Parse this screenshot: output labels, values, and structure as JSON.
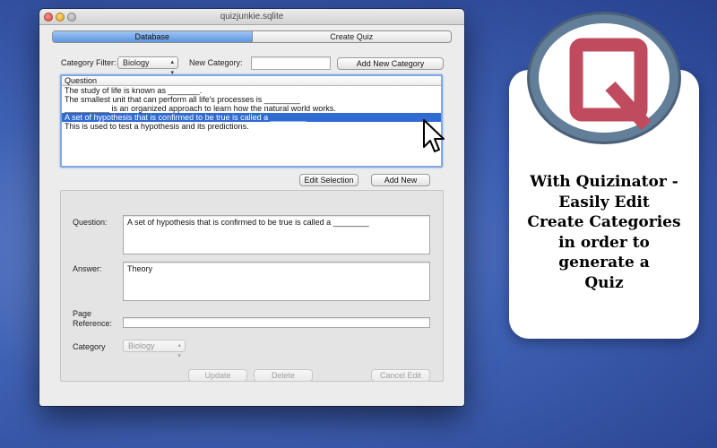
{
  "window": {
    "title": "quizjunkie.sqlite"
  },
  "tabs": [
    {
      "label": "Database",
      "active": true
    },
    {
      "label": "Create Quiz",
      "active": false
    }
  ],
  "filter_bar": {
    "category_filter_label": "Category Filter:",
    "category_filter_value": "Biology",
    "new_category_label": "New Category:",
    "new_category_value": "",
    "add_category_button": "Add New Category"
  },
  "question_table": {
    "column_header": "Question",
    "rows": [
      "The study of life is known as _______.",
      "The smallest unit that can perform all life's processes is ________",
      "__________ is an organized approach to learn how the natural world works.",
      "A set of hypothesis that is confirmed to be true is called a ________",
      "This is used to test a hypothesis and its predictions."
    ],
    "selected_index": 3
  },
  "table_actions": {
    "edit_selection": "Edit Selection",
    "add_new": "Add New"
  },
  "editor": {
    "question_label": "Question:",
    "question_value": "A set of hypothesis that is confirmed to be true is called a ________",
    "answer_label": "Answer:",
    "answer_value": "Theory",
    "page_reference_label": "Page\nReference:",
    "page_reference_value": "",
    "category_label": "Category",
    "category_value": "Biology",
    "update_button": "Update",
    "delete_button": "Delete",
    "cancel_button": "Cancel Edit"
  },
  "promo": {
    "lines": [
      "With Quizinator -",
      "Easily Edit",
      "Create Categories",
      "in order to",
      "generate a",
      "Quiz"
    ],
    "logo_letter": "Q"
  },
  "colors": {
    "selection": "#2f6bd0",
    "logo_q": "#c04a5e",
    "logo_ring": "#627e98",
    "desktop": "#3f61b4"
  },
  "icons": {
    "cursor": "arrow-pointer-icon",
    "popup_arrows": "updown-chevron-icon"
  }
}
